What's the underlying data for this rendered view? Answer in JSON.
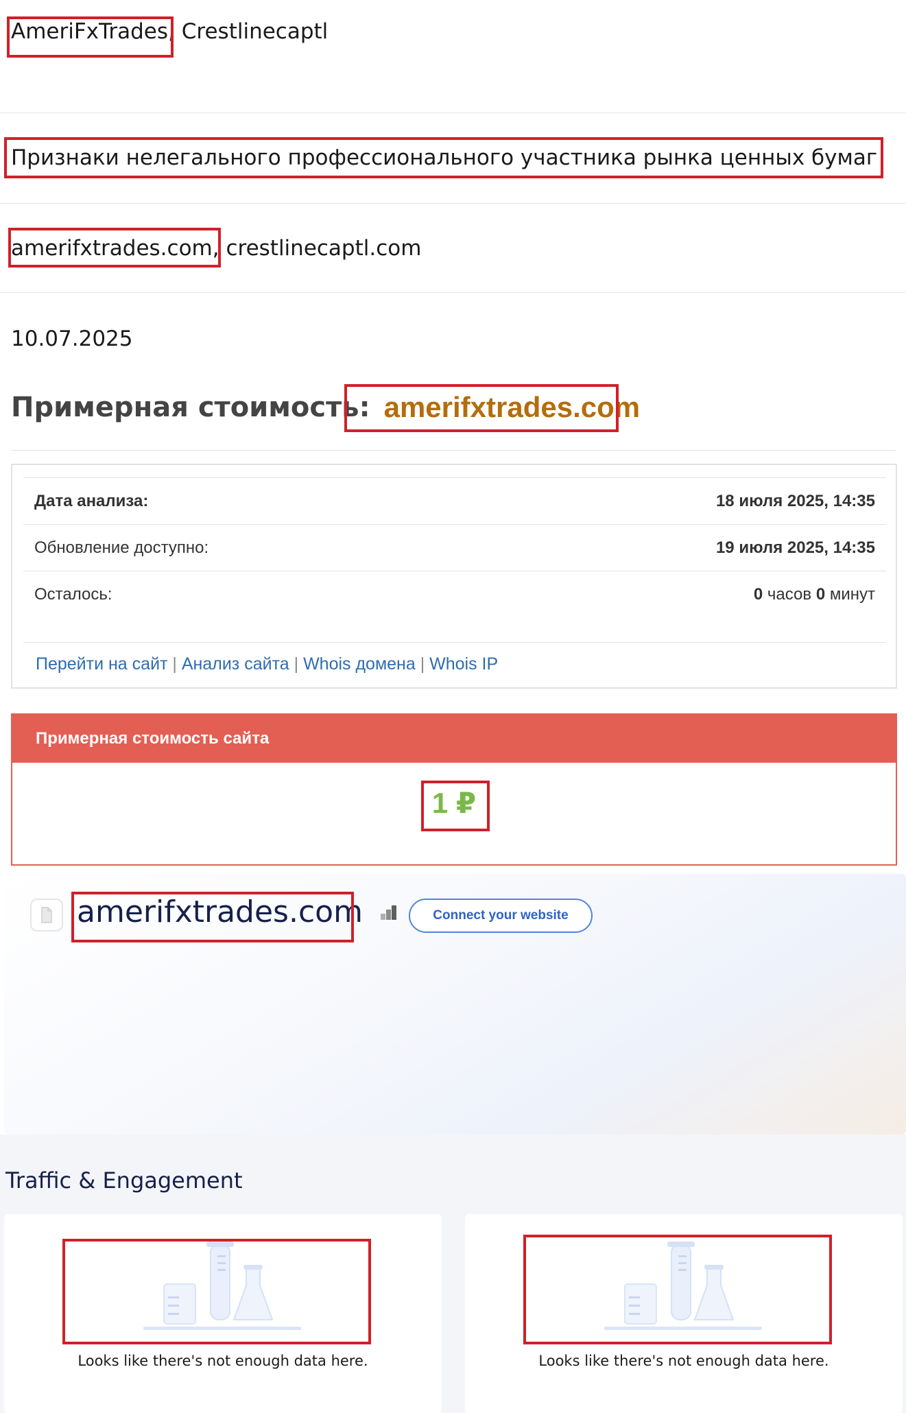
{
  "names": {
    "first": "AmeriFxTrades",
    "rest": ", Crestlinecaptl"
  },
  "sign": "Признаки нелегального профессионального участника рынка ценных бумаг",
  "domains": {
    "first": "amerifxtrades.com",
    "rest": ", crestlinecaptl.com"
  },
  "date": "10.07.2025",
  "title": {
    "prefix": "Примерная стоимость:",
    "domain": "amerifxtrades.com"
  },
  "analysis": {
    "date_label": "Дата анализа:",
    "date_value": "18 июля 2025, 14:35",
    "update_label": "Обновление доступно:",
    "update_value": "19 июля 2025, 14:35",
    "left_label": "Осталось:",
    "left_hours": "0",
    "left_hours_unit": " часов ",
    "left_minutes": "0",
    "left_minutes_unit": " минут",
    "links": [
      "Перейти на сайт",
      "Анализ сайта",
      "Whois домена",
      "Whois IP"
    ],
    "link_separator": " | "
  },
  "price": {
    "header": "Примерная стоимость сайта",
    "value": "1 ₽"
  },
  "site": {
    "domain": "amerifxtrades.com",
    "connect_label": "Connect your website"
  },
  "traffic": {
    "title": "Traffic & Engagement",
    "empty_left": "Looks like there's not enough data here.",
    "empty_right": "Looks like there's not enough data here."
  },
  "colors": {
    "highlight": "#d0202a",
    "price_header": "#e35f53",
    "price_value": "#7ab84a",
    "domain_orange": "#b46d0c",
    "link_blue": "#2e6db0"
  }
}
